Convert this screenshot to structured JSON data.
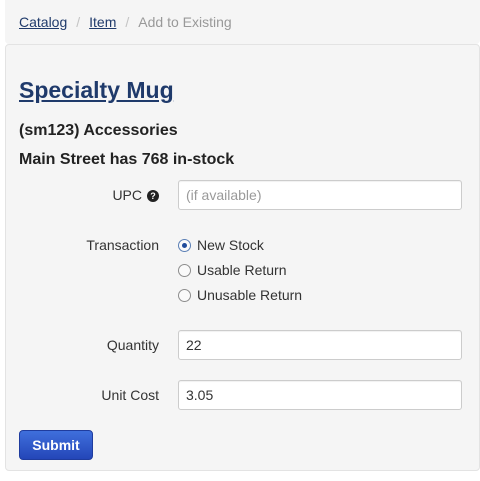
{
  "breadcrumb": {
    "items": [
      {
        "label": "Catalog"
      },
      {
        "label": "Item"
      },
      {
        "label": "Add to Existing"
      }
    ],
    "separator": "/"
  },
  "product": {
    "title": "Specialty Mug",
    "sku_line": "(sm123) Accessories",
    "stock_line": "Main Street has 768 in-stock"
  },
  "form": {
    "upc": {
      "label": "UPC",
      "placeholder": "(if available)",
      "value": "",
      "help_icon": "question-circle-icon"
    },
    "transaction": {
      "label": "Transaction",
      "options": [
        {
          "label": "New Stock",
          "selected": true
        },
        {
          "label": "Usable Return",
          "selected": false
        },
        {
          "label": "Unusable Return",
          "selected": false
        }
      ]
    },
    "quantity": {
      "label": "Quantity",
      "value": "22"
    },
    "unit_cost": {
      "label": "Unit Cost",
      "value": "3.05"
    },
    "submit_label": "Submit"
  },
  "colors": {
    "link": "#1f3a6b",
    "panel_bg": "#f5f5f5",
    "primary_button": "#2f56c9"
  }
}
